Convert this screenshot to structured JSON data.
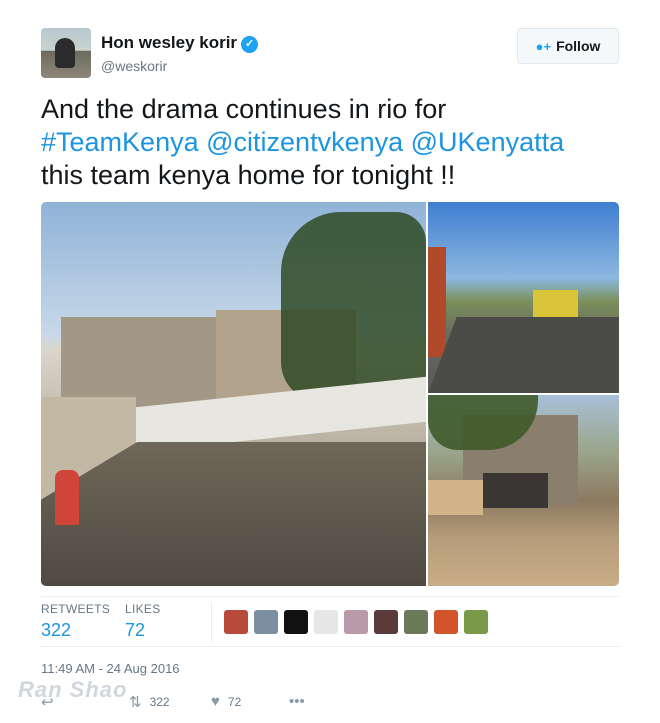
{
  "user": {
    "name": "Hon wesley korir",
    "handle": "@weskorir",
    "verified_icon": "✓"
  },
  "follow_button": {
    "label": "Follow",
    "icon": "add-user-icon"
  },
  "tweet": {
    "text_line1": "And the drama continues in rio for",
    "hashtag": "#TeamKenya",
    "mention1": "@citizentvkenya",
    "mention2": "@UKenyatta",
    "text_line3": "this team kenya home for tonight !!"
  },
  "stats": {
    "retweets_label": "RETWEETS",
    "retweets_value": "322",
    "likes_label": "LIKES",
    "likes_value": "72"
  },
  "timestamp": "11:49 AM - 24 Aug 2016",
  "actions": {
    "retweet_count": "322",
    "like_count": "72"
  },
  "watermark": "Ran Shao",
  "colors": {
    "link": "#1b95e0",
    "verified": "#1da1f2",
    "muted": "#657786"
  }
}
